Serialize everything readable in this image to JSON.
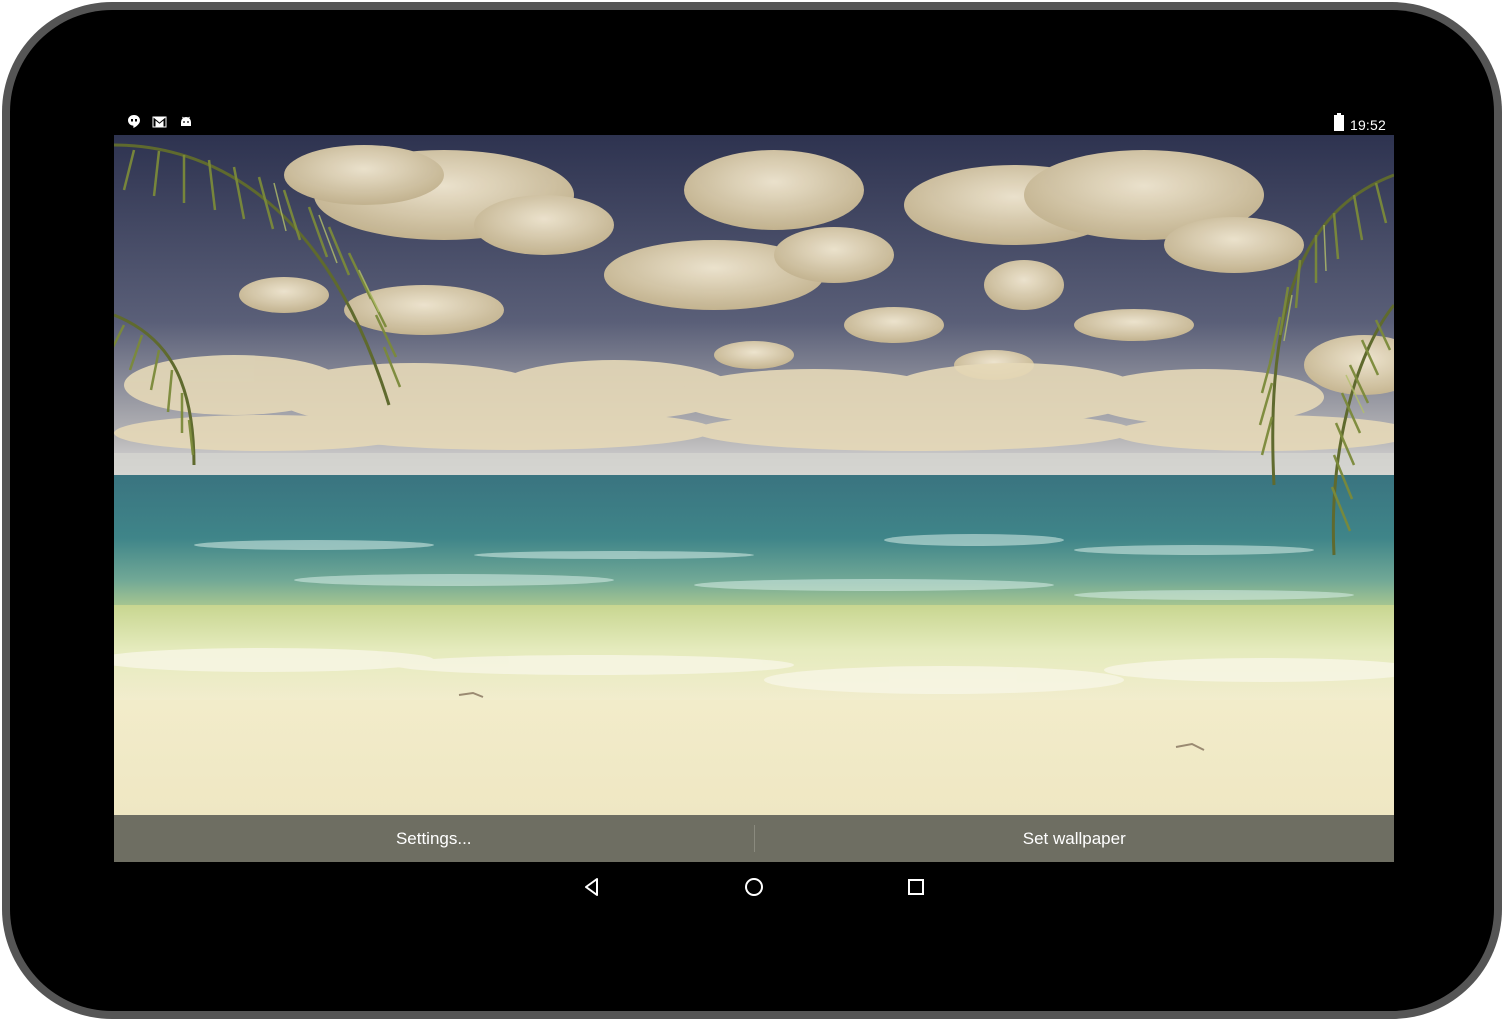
{
  "status_bar": {
    "icons": [
      "hangouts-icon",
      "gmail-icon",
      "android-icon"
    ],
    "battery_icon": "battery-full-icon",
    "time": "19:52"
  },
  "wallpaper": {
    "scene": "tropical-beach",
    "colors": {
      "sky_top": "#2e3350",
      "sky_horizon": "#cfcfd2",
      "cloud": "#e8dcc0",
      "sea_far": "#3e7d82",
      "sea_near": "#6aa79a",
      "shallow": "#d3dba0",
      "sand": "#f2eccb",
      "palm": "#6f7a3a"
    }
  },
  "action_bar": {
    "settings_label": "Settings...",
    "set_wallpaper_label": "Set wallpaper",
    "background": "#6e6e62"
  },
  "nav_bar": {
    "back": "back-icon",
    "home": "home-icon",
    "recents": "recents-icon"
  }
}
